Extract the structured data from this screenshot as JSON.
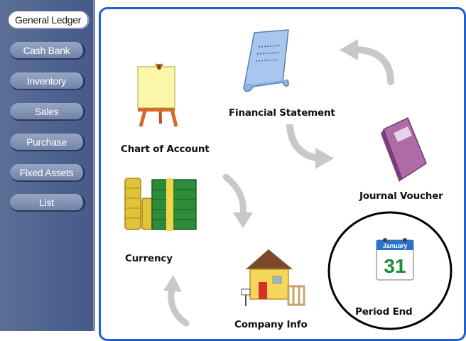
{
  "sidebar": {
    "items": [
      {
        "label": "General Ledger",
        "active": true
      },
      {
        "label": "Cash Bank"
      },
      {
        "label": "Inventory"
      },
      {
        "label": "Sales"
      },
      {
        "label": "Purchase"
      },
      {
        "label": "Fixed Assets"
      },
      {
        "label": "List"
      }
    ]
  },
  "main": {
    "items": {
      "chart_of_account": {
        "label": "Chart of Account",
        "icon": "easel-icon"
      },
      "financial_statement": {
        "label": "Financial Statement",
        "icon": "scroll-icon"
      },
      "journal_voucher": {
        "label": "Journal Voucher",
        "icon": "book-icon"
      },
      "currency": {
        "label": "Currency",
        "icon": "money-icon"
      },
      "company_info": {
        "label": "Company Info",
        "icon": "house-icon"
      },
      "period_end": {
        "label": "Period End",
        "icon": "calendar-icon",
        "calendar_month": "January",
        "calendar_day": "31",
        "highlighted": true
      }
    }
  },
  "colors": {
    "sidebar_bg": "#4e6290",
    "panel_border": "#1f5fd6",
    "arrow": "#c8c8c8",
    "highlight_ring": "#000000"
  }
}
